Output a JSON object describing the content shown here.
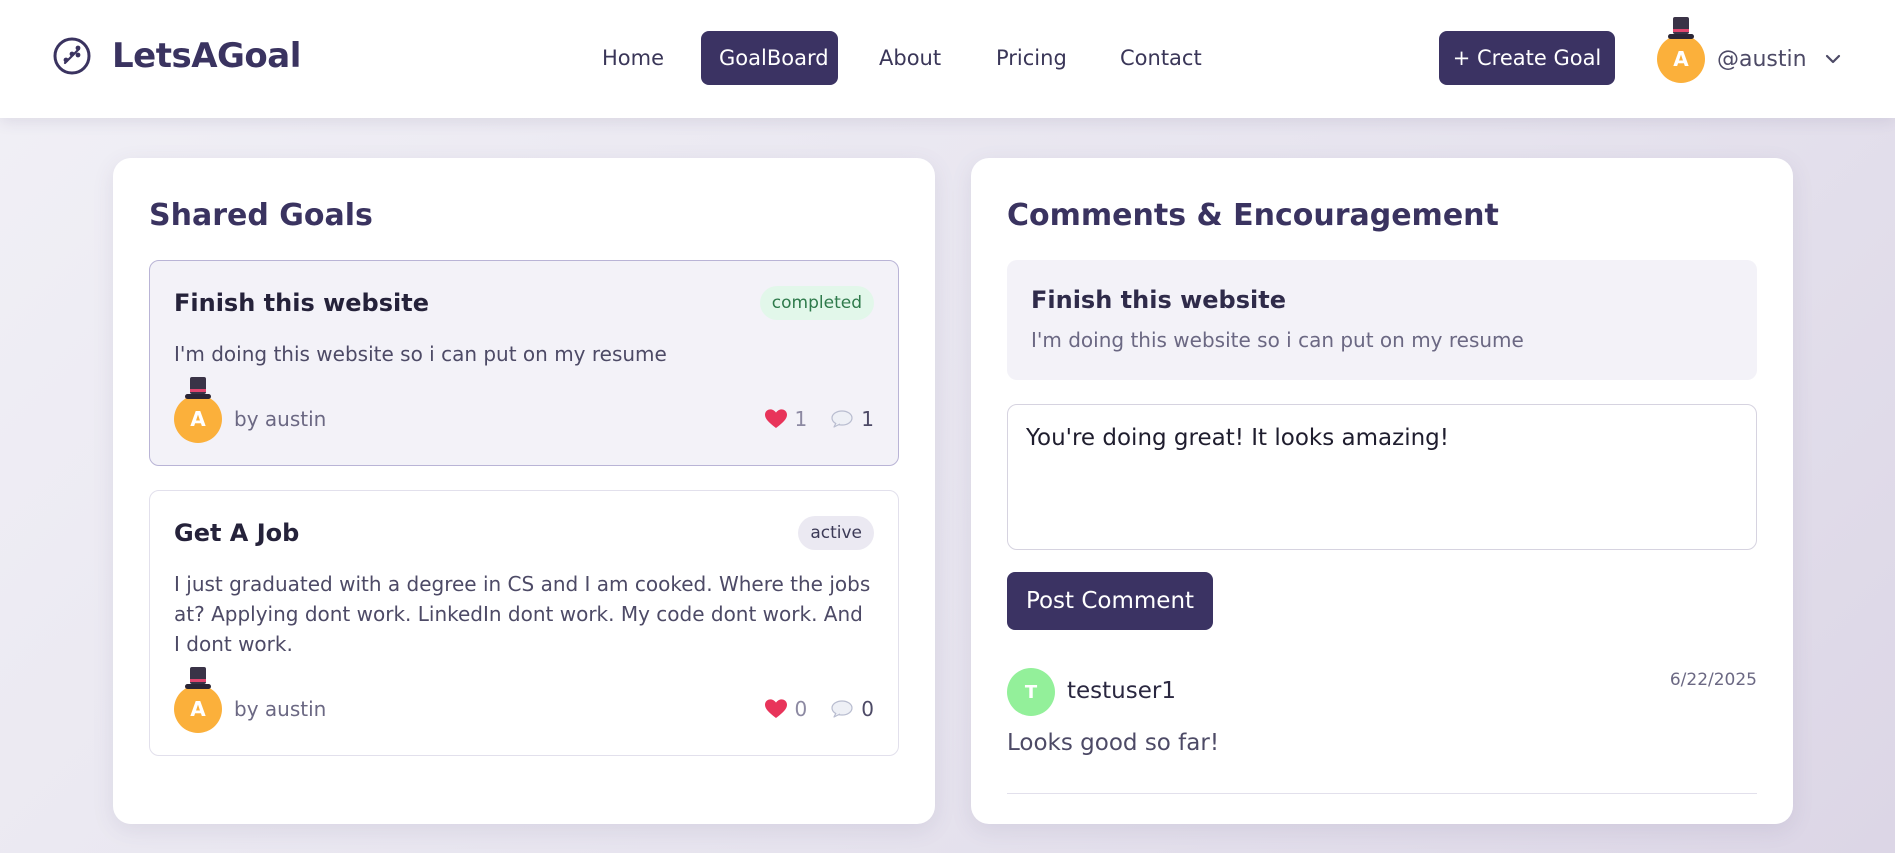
{
  "brand": {
    "name": "LetsAGoal"
  },
  "nav": {
    "items": [
      {
        "label": "Home"
      },
      {
        "label": "GoalBoard",
        "active": true
      },
      {
        "label": "About"
      },
      {
        "label": "Pricing"
      },
      {
        "label": "Contact"
      }
    ],
    "create_label": "+ Create Goal"
  },
  "user": {
    "initial": "A",
    "handle": "@austin",
    "avatar_color": "#fbb03b"
  },
  "shared_goals": {
    "title": "Shared Goals",
    "goals": [
      {
        "title": "Finish this website",
        "status": "completed",
        "description": "I'm doing this website so i can put on my resume",
        "author_initial": "A",
        "author": "by austin",
        "likes": "1",
        "comments": "1"
      },
      {
        "title": "Get A Job",
        "status": "active",
        "description": "I just graduated with a degree in CS and I am cooked. Where the jobs at? Applying dont work. LinkedIn dont work. My code dont work. And I dont work.",
        "author_initial": "A",
        "author": "by austin",
        "likes": "0",
        "comments": "0"
      }
    ]
  },
  "comments_panel": {
    "title": "Comments & Encouragement",
    "selected_goal": {
      "title": "Finish this website",
      "description": "I'm doing this website so i can put on my resume"
    },
    "input_value": "You're doing great! It looks amazing!",
    "post_label": "Post Comment",
    "comments": [
      {
        "initial": "T",
        "user": "testuser1",
        "date": "6/22/2025",
        "text": "Looks good so far!",
        "avatar_color": "#93f09a"
      }
    ]
  },
  "colors": {
    "primary": "#3b3363",
    "like": "#e8345a",
    "completed_bg": "#e2f7ea",
    "active_bg": "#ebe9f2"
  }
}
